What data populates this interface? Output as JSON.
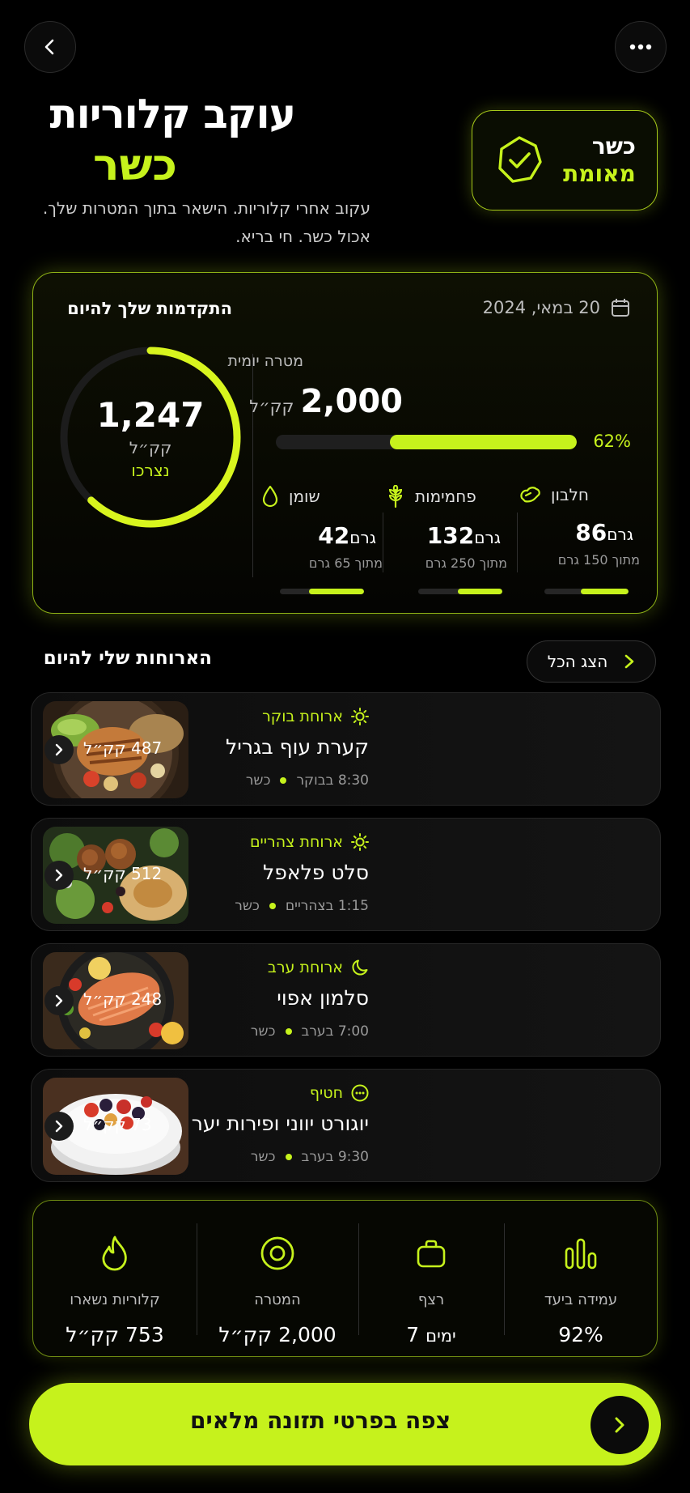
{
  "header": {
    "title_line1": "עוקב קלוריות",
    "title_line2": "כשר",
    "subtitle": "עקוב אחרי קלוריות. הישאר בתוך המטרות שלך. אכול כשר. חי בריא.",
    "badge_line1": "כשר",
    "badge_line2": "מאומת"
  },
  "progress": {
    "title": "התקדמות שלך להיום",
    "date": "20 במאי, 2024",
    "consumed": "1,247",
    "consumed_unit": "קק״ל",
    "consumed_label": "נצרכו",
    "ring_fraction": 0.62,
    "goal_label": "מטרה יומית",
    "goal_value": "2,000",
    "goal_unit": "קק״ל",
    "goal_percent_text": "62%",
    "goal_fraction": 0.62,
    "macros": [
      {
        "name": "חלבון",
        "icon": "protein-icon",
        "value": "86",
        "unit": "גרם",
        "of": "מתוך 150 גרם",
        "fraction": 0.57
      },
      {
        "name": "פחמימות",
        "icon": "wheat-icon",
        "value": "132",
        "unit": "גרם",
        "of": "מתוך 250 גרם",
        "fraction": 0.53
      },
      {
        "name": "שומן",
        "icon": "drop-icon",
        "value": "42",
        "unit": "גרם",
        "of": "מתוך 65 גרם",
        "fraction": 0.65
      }
    ]
  },
  "meals_section": {
    "title": "הארוחות שלי להיום",
    "see_all": "הצג הכל"
  },
  "meals": [
    {
      "category": "ארוחת בוקר",
      "icon": "sun-icon",
      "name": "קערת עוף בגריל",
      "time": "8:30 בבוקר",
      "tag": "כשר",
      "kcal": "487 קק״ל"
    },
    {
      "category": "ארוחת צהריים",
      "icon": "sun-icon",
      "name": "סלט פלאפל",
      "time": "1:15 בצהריים",
      "tag": "כשר",
      "kcal": "512 קק״ל"
    },
    {
      "category": "ארוחת ערב",
      "icon": "moon-icon",
      "name": "סלמון אפוי",
      "time": "7:00 בערב",
      "tag": "כשר",
      "kcal": "248 קק״ל"
    },
    {
      "category": "חטיף",
      "icon": "dots-icon",
      "name": "יוגורט יווני ופירות יער",
      "time": "9:30 בערב",
      "tag": "כשר",
      "kcal": "73 קק״ל"
    }
  ],
  "stats": [
    {
      "label": "עמידה ביעד",
      "value": "92%",
      "icon": "bars-icon"
    },
    {
      "label": "רצף",
      "value": "7",
      "unit": "ימים",
      "icon": "streak-icon"
    },
    {
      "label": "המטרה",
      "value": "2,000 קק״ל",
      "icon": "target-icon"
    },
    {
      "label": "קלוריות נשארו",
      "value": "753 קק״ל",
      "icon": "flame-icon"
    }
  ],
  "cta": {
    "label": "צפה בפרטי תזונה מלאים"
  },
  "colors": {
    "accent": "#c6f21c",
    "background": "#000000"
  }
}
